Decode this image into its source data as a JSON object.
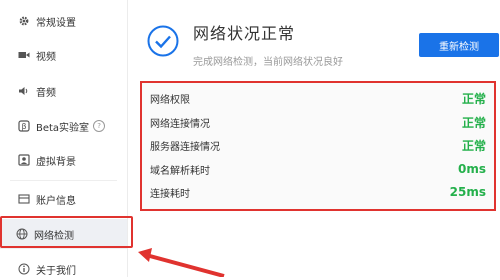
{
  "sidebar": {
    "items": [
      {
        "label": "常规设置",
        "icon": "gear-icon"
      },
      {
        "label": "视频",
        "icon": "video-icon"
      },
      {
        "label": "音频",
        "icon": "speaker-icon"
      },
      {
        "label": "Beta实验室",
        "icon": "beta-icon"
      },
      {
        "label": "虚拟背景",
        "icon": "portrait-icon"
      },
      {
        "label": "账户信息",
        "icon": "account-icon"
      },
      {
        "label": "网络检测",
        "icon": "globe-icon"
      },
      {
        "label": "关于我们",
        "icon": "info-icon"
      }
    ],
    "active_index": 6,
    "help_glyph": "?"
  },
  "main": {
    "status_title": "网络状况正常",
    "status_subtitle": "完成网络检测，当前网络状况良好",
    "recheck_label": "重新检测",
    "checks": [
      {
        "label": "网络权限",
        "value": "正常"
      },
      {
        "label": "网络连接情况",
        "value": "正常"
      },
      {
        "label": "服务器连接情况",
        "value": "正常"
      },
      {
        "label": "域名解析耗时",
        "value": "0ms"
      },
      {
        "label": "连接耗时",
        "value": "25ms"
      }
    ]
  },
  "colors": {
    "accent": "#1a73e8",
    "ok_green": "#24b04b",
    "annotation_red": "#e0332f"
  }
}
